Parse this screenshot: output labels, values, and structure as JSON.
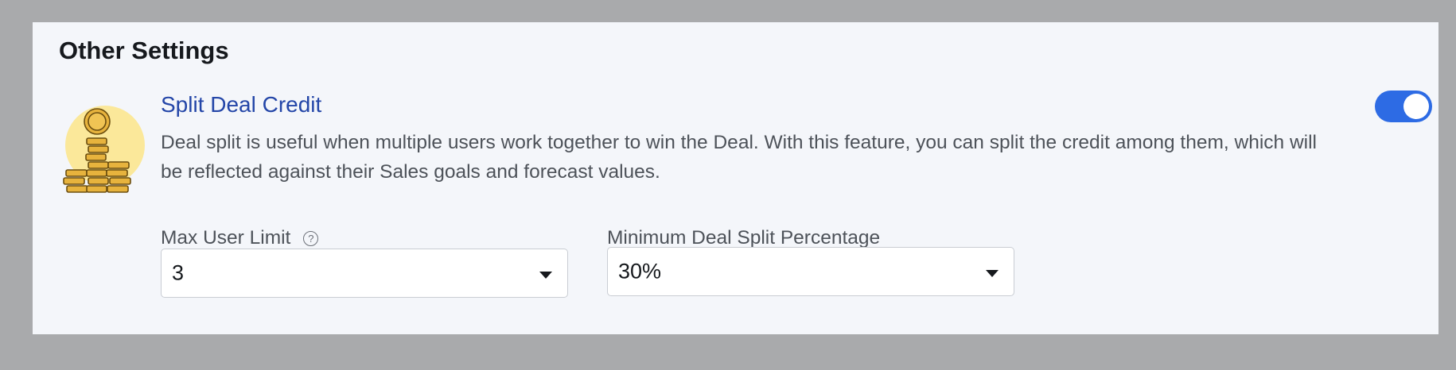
{
  "section": {
    "title": "Other Settings"
  },
  "feature": {
    "title": "Split Deal Credit",
    "description": "Deal split is useful when multiple users work together to win the Deal. With this feature, you can split the credit among them, which will be reflected against their Sales goals and forecast values.",
    "enabled": true,
    "icon": "coins-stack-icon"
  },
  "fields": {
    "max_user_limit": {
      "label": "Max User Limit",
      "help_icon": "?",
      "value": "3"
    },
    "min_split_percentage": {
      "label": "Minimum Deal Split Percentage",
      "value": "30%"
    }
  },
  "colors": {
    "accent": "#2d6be4",
    "title_link": "#2446a8",
    "illustration_blob": "#fbe89a",
    "coin": "#e7b33d"
  }
}
